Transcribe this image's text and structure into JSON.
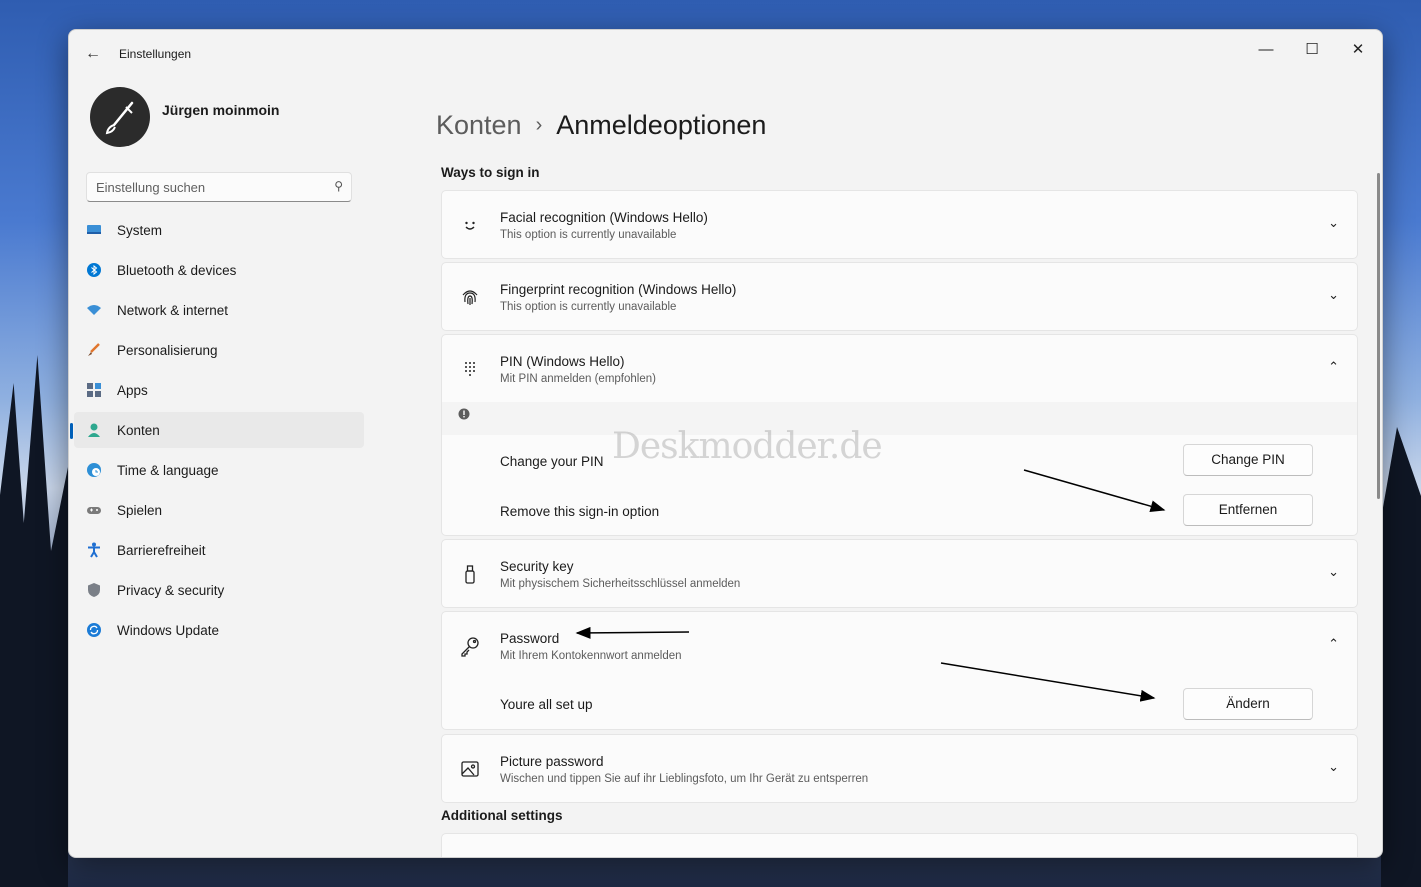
{
  "window": {
    "title": "Einstellungen",
    "controls": {
      "minimize": "—",
      "maximize": "☐",
      "close": "✕"
    }
  },
  "user": {
    "name": "Jürgen moinmoin"
  },
  "search": {
    "placeholder": "Einstellung suchen"
  },
  "sidebar": {
    "items": [
      {
        "label": "System",
        "icon": "monitor-icon",
        "color": "#3a8fd6"
      },
      {
        "label": "Bluetooth & devices",
        "icon": "bluetooth-icon",
        "color": "#0078d4"
      },
      {
        "label": "Network & internet",
        "icon": "wifi-icon",
        "color": "#3a8fd6"
      },
      {
        "label": "Personalisierung",
        "icon": "brush-icon",
        "color": "#e0752d"
      },
      {
        "label": "Apps",
        "icon": "apps-icon",
        "color": "#5b6b84"
      },
      {
        "label": "Konten",
        "icon": "person-icon",
        "color": "#2ea88f",
        "active": true
      },
      {
        "label": "Time & language",
        "icon": "globe-clock-icon",
        "color": "#2d8fd6"
      },
      {
        "label": "Spielen",
        "icon": "gamepad-icon",
        "color": "#7a7a7a"
      },
      {
        "label": "Barrierefreiheit",
        "icon": "accessibility-icon",
        "color": "#1f6fd1"
      },
      {
        "label": "Privacy & security",
        "icon": "shield-icon",
        "color": "#7a7f87"
      },
      {
        "label": "Windows Update",
        "icon": "update-icon",
        "color": "#1b7bd6"
      }
    ]
  },
  "breadcrumb": {
    "parent": "Konten",
    "separator": "›",
    "current": "Anmeldeoptionen"
  },
  "ways": {
    "title": "Ways to sign in",
    "facial": {
      "title": "Facial recognition (Windows Hello)",
      "subtitle": "This option is currently unavailable",
      "icon": "smile-icon"
    },
    "fingerprint": {
      "title": "Fingerprint recognition (Windows Hello)",
      "subtitle": "This option is currently unavailable",
      "icon": "fingerprint-icon"
    },
    "pin": {
      "title": "PIN (Windows Hello)",
      "subtitle": "Mit PIN anmelden (empfohlen)",
      "icon": "keypad-icon",
      "change_label": "Change your PIN",
      "change_button": "Change PIN",
      "remove_label": "Remove this sign-in option",
      "remove_button": "Entfernen"
    },
    "security_key": {
      "title": "Security key",
      "subtitle": "Mit physischem Sicherheitsschlüssel anmelden",
      "icon": "usb-key-icon"
    },
    "password": {
      "title": "Password",
      "subtitle": "Mit Ihrem Kontokennwort anmelden",
      "icon": "key-icon",
      "status": "Youre all set up",
      "change_button": "Ändern"
    },
    "picture": {
      "title": "Picture password",
      "subtitle": "Wischen und tippen Sie auf ihr Lieblingsfoto, um Ihr Gerät zu entsperren",
      "icon": "picture-icon"
    }
  },
  "additional": {
    "title": "Additional settings"
  },
  "watermark": "Deskmodder.de",
  "chevrons": {
    "down": "⌄",
    "up": "⌃"
  }
}
